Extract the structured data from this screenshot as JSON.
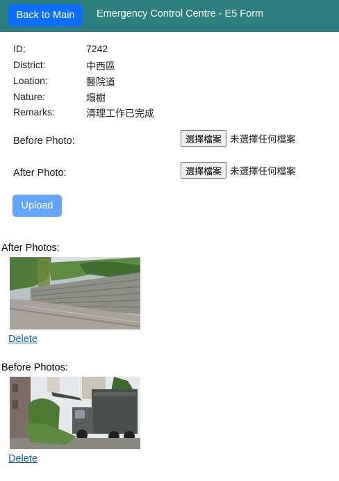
{
  "header": {
    "back_label": "Back to Main",
    "title": "Emergency Control Centre - E5 Form"
  },
  "details": [
    {
      "label": "ID:",
      "value": "7242"
    },
    {
      "label": "District:",
      "value": "中西區"
    },
    {
      "label": "Loation:",
      "value": "醫院道"
    },
    {
      "label": "Nature:",
      "value": "塌樹"
    },
    {
      "label": "Remarks:",
      "value": "清理工作已完成"
    }
  ],
  "upload_form": {
    "before_label": "Before Photo:",
    "after_label": "After Photo:",
    "choose_file_label": "選擇檔案",
    "no_file_text": "未選擇任何檔案",
    "upload_label": "Upload"
  },
  "after_photos": {
    "heading": "After Photos:",
    "delete_label": "Delete"
  },
  "before_photos": {
    "heading": "Before Photos:",
    "delete_label": "Delete"
  },
  "colors": {
    "header_bg": "#2d7f7f",
    "primary": "#0d6efd",
    "upload_disabled": "#62a5fc",
    "link": "#0d5ec9"
  }
}
